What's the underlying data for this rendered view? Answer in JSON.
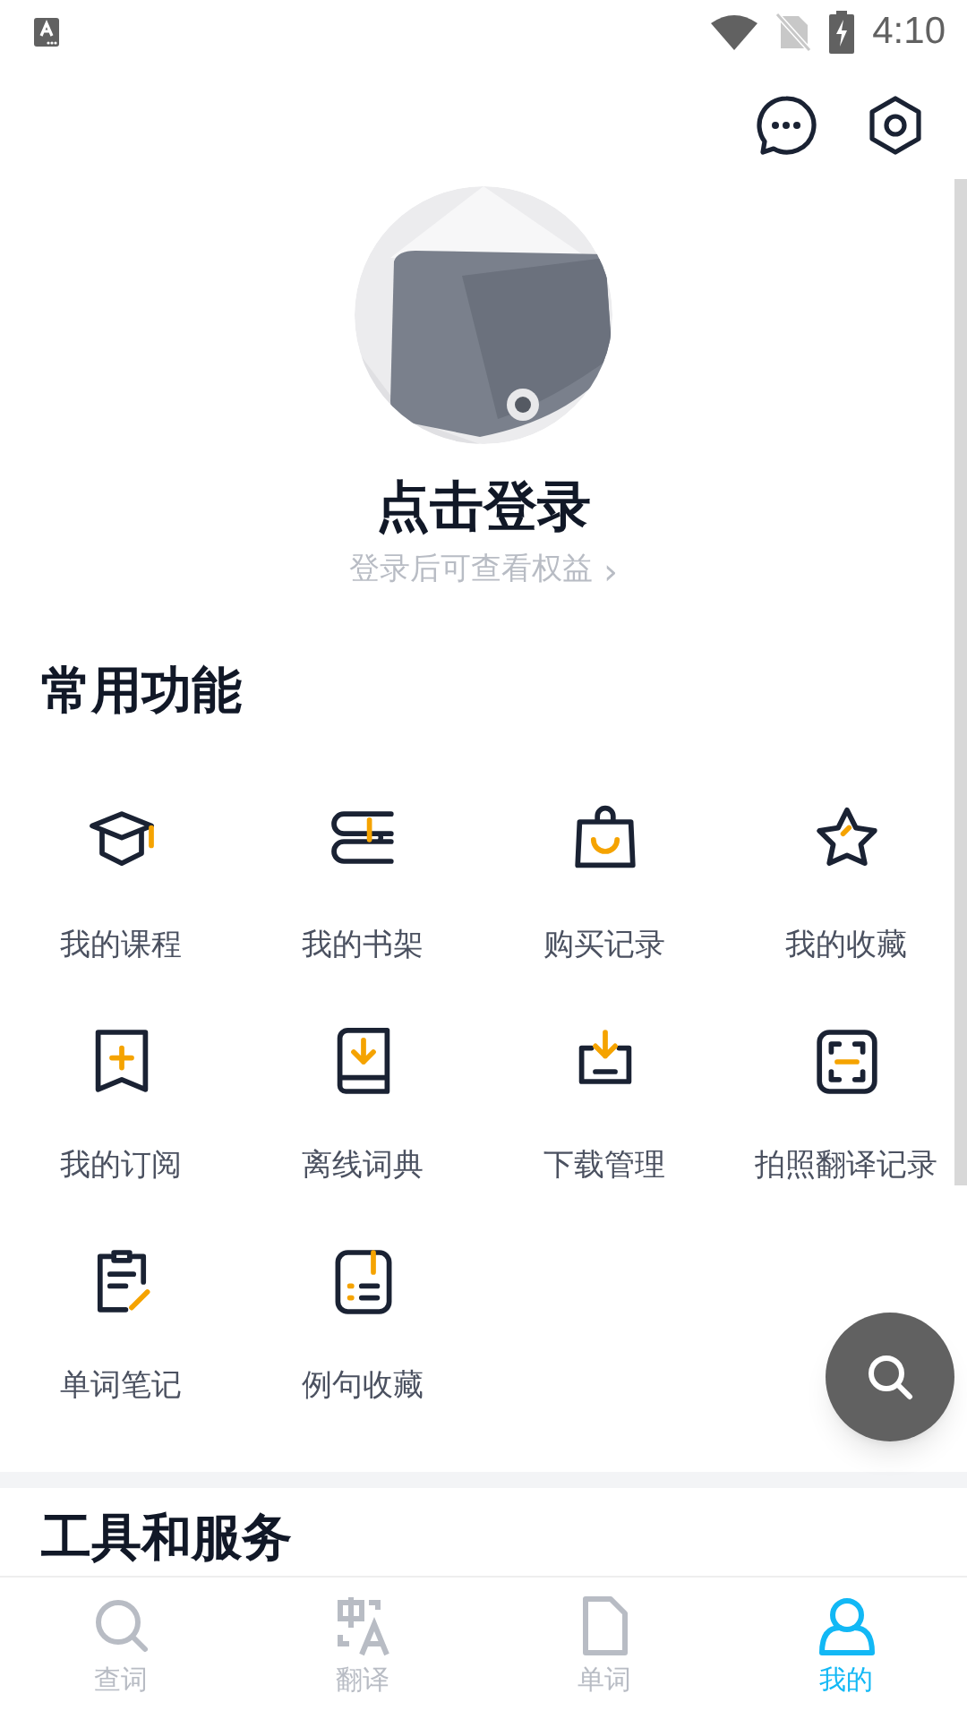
{
  "status_bar": {
    "time": "4:10"
  },
  "profile": {
    "title": "点击登录",
    "subtitle": "登录后可查看权益",
    "chevron": "›"
  },
  "common_functions": {
    "title": "常用功能",
    "items": [
      {
        "label": "我的课程"
      },
      {
        "label": "我的书架"
      },
      {
        "label": "购买记录"
      },
      {
        "label": "我的收藏"
      },
      {
        "label": "我的订阅"
      },
      {
        "label": "离线词典"
      },
      {
        "label": "下载管理"
      },
      {
        "label": "拍照翻译记录"
      },
      {
        "label": "单词笔记"
      },
      {
        "label": "例句收藏"
      }
    ]
  },
  "tools_section": {
    "title": "工具和服务"
  },
  "tabs": [
    {
      "label": "查词",
      "selected": false
    },
    {
      "label": "翻译",
      "selected": false
    },
    {
      "label": "单词",
      "selected": false
    },
    {
      "label": "我的",
      "selected": true
    }
  ]
}
